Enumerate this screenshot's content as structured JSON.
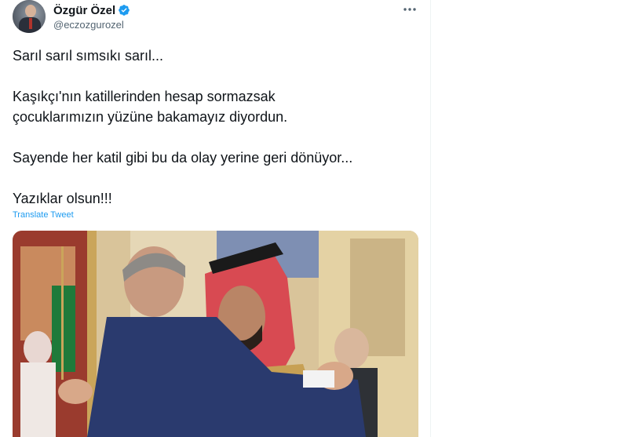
{
  "tweet": {
    "display_name": "Özgür Özel",
    "handle": "@eczozgurozel",
    "paragraphs": [
      [
        "Sarıl sarıl sımsıkı sarıl..."
      ],
      [
        "Kaşıkçı'nın katillerinden hesap sormazsak",
        "çocuklarımızın yüzüne bakamayız diyordun."
      ],
      [
        "Sayende her katil gibi bu da olay yerine geri dönüyor..."
      ],
      [
        "Yazıklar olsun!!!"
      ]
    ],
    "translate_label": "Translate Tweet"
  },
  "colors": {
    "verified": "#1d9bf0",
    "link": "#1d9bf0",
    "text": "#0f1419",
    "secondary": "#536471"
  },
  "icons": {
    "verified": "verified-badge-icon",
    "more": "more-options-icon"
  }
}
